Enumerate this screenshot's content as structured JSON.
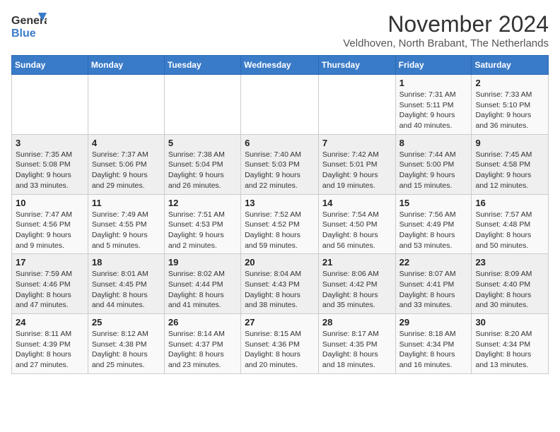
{
  "logo": {
    "line1": "General",
    "line2": "Blue"
  },
  "title": "November 2024",
  "location": "Veldhoven, North Brabant, The Netherlands",
  "days_of_week": [
    "Sunday",
    "Monday",
    "Tuesday",
    "Wednesday",
    "Thursday",
    "Friday",
    "Saturday"
  ],
  "weeks": [
    [
      {
        "day": "",
        "info": ""
      },
      {
        "day": "",
        "info": ""
      },
      {
        "day": "",
        "info": ""
      },
      {
        "day": "",
        "info": ""
      },
      {
        "day": "",
        "info": ""
      },
      {
        "day": "1",
        "info": "Sunrise: 7:31 AM\nSunset: 5:11 PM\nDaylight: 9 hours\nand 40 minutes."
      },
      {
        "day": "2",
        "info": "Sunrise: 7:33 AM\nSunset: 5:10 PM\nDaylight: 9 hours\nand 36 minutes."
      }
    ],
    [
      {
        "day": "3",
        "info": "Sunrise: 7:35 AM\nSunset: 5:08 PM\nDaylight: 9 hours\nand 33 minutes."
      },
      {
        "day": "4",
        "info": "Sunrise: 7:37 AM\nSunset: 5:06 PM\nDaylight: 9 hours\nand 29 minutes."
      },
      {
        "day": "5",
        "info": "Sunrise: 7:38 AM\nSunset: 5:04 PM\nDaylight: 9 hours\nand 26 minutes."
      },
      {
        "day": "6",
        "info": "Sunrise: 7:40 AM\nSunset: 5:03 PM\nDaylight: 9 hours\nand 22 minutes."
      },
      {
        "day": "7",
        "info": "Sunrise: 7:42 AM\nSunset: 5:01 PM\nDaylight: 9 hours\nand 19 minutes."
      },
      {
        "day": "8",
        "info": "Sunrise: 7:44 AM\nSunset: 5:00 PM\nDaylight: 9 hours\nand 15 minutes."
      },
      {
        "day": "9",
        "info": "Sunrise: 7:45 AM\nSunset: 4:58 PM\nDaylight: 9 hours\nand 12 minutes."
      }
    ],
    [
      {
        "day": "10",
        "info": "Sunrise: 7:47 AM\nSunset: 4:56 PM\nDaylight: 9 hours\nand 9 minutes."
      },
      {
        "day": "11",
        "info": "Sunrise: 7:49 AM\nSunset: 4:55 PM\nDaylight: 9 hours\nand 5 minutes."
      },
      {
        "day": "12",
        "info": "Sunrise: 7:51 AM\nSunset: 4:53 PM\nDaylight: 9 hours\nand 2 minutes."
      },
      {
        "day": "13",
        "info": "Sunrise: 7:52 AM\nSunset: 4:52 PM\nDaylight: 8 hours\nand 59 minutes."
      },
      {
        "day": "14",
        "info": "Sunrise: 7:54 AM\nSunset: 4:50 PM\nDaylight: 8 hours\nand 56 minutes."
      },
      {
        "day": "15",
        "info": "Sunrise: 7:56 AM\nSunset: 4:49 PM\nDaylight: 8 hours\nand 53 minutes."
      },
      {
        "day": "16",
        "info": "Sunrise: 7:57 AM\nSunset: 4:48 PM\nDaylight: 8 hours\nand 50 minutes."
      }
    ],
    [
      {
        "day": "17",
        "info": "Sunrise: 7:59 AM\nSunset: 4:46 PM\nDaylight: 8 hours\nand 47 minutes."
      },
      {
        "day": "18",
        "info": "Sunrise: 8:01 AM\nSunset: 4:45 PM\nDaylight: 8 hours\nand 44 minutes."
      },
      {
        "day": "19",
        "info": "Sunrise: 8:02 AM\nSunset: 4:44 PM\nDaylight: 8 hours\nand 41 minutes."
      },
      {
        "day": "20",
        "info": "Sunrise: 8:04 AM\nSunset: 4:43 PM\nDaylight: 8 hours\nand 38 minutes."
      },
      {
        "day": "21",
        "info": "Sunrise: 8:06 AM\nSunset: 4:42 PM\nDaylight: 8 hours\nand 35 minutes."
      },
      {
        "day": "22",
        "info": "Sunrise: 8:07 AM\nSunset: 4:41 PM\nDaylight: 8 hours\nand 33 minutes."
      },
      {
        "day": "23",
        "info": "Sunrise: 8:09 AM\nSunset: 4:40 PM\nDaylight: 8 hours\nand 30 minutes."
      }
    ],
    [
      {
        "day": "24",
        "info": "Sunrise: 8:11 AM\nSunset: 4:39 PM\nDaylight: 8 hours\nand 27 minutes."
      },
      {
        "day": "25",
        "info": "Sunrise: 8:12 AM\nSunset: 4:38 PM\nDaylight: 8 hours\nand 25 minutes."
      },
      {
        "day": "26",
        "info": "Sunrise: 8:14 AM\nSunset: 4:37 PM\nDaylight: 8 hours\nand 23 minutes."
      },
      {
        "day": "27",
        "info": "Sunrise: 8:15 AM\nSunset: 4:36 PM\nDaylight: 8 hours\nand 20 minutes."
      },
      {
        "day": "28",
        "info": "Sunrise: 8:17 AM\nSunset: 4:35 PM\nDaylight: 8 hours\nand 18 minutes."
      },
      {
        "day": "29",
        "info": "Sunrise: 8:18 AM\nSunset: 4:34 PM\nDaylight: 8 hours\nand 16 minutes."
      },
      {
        "day": "30",
        "info": "Sunrise: 8:20 AM\nSunset: 4:34 PM\nDaylight: 8 hours\nand 13 minutes."
      }
    ]
  ]
}
